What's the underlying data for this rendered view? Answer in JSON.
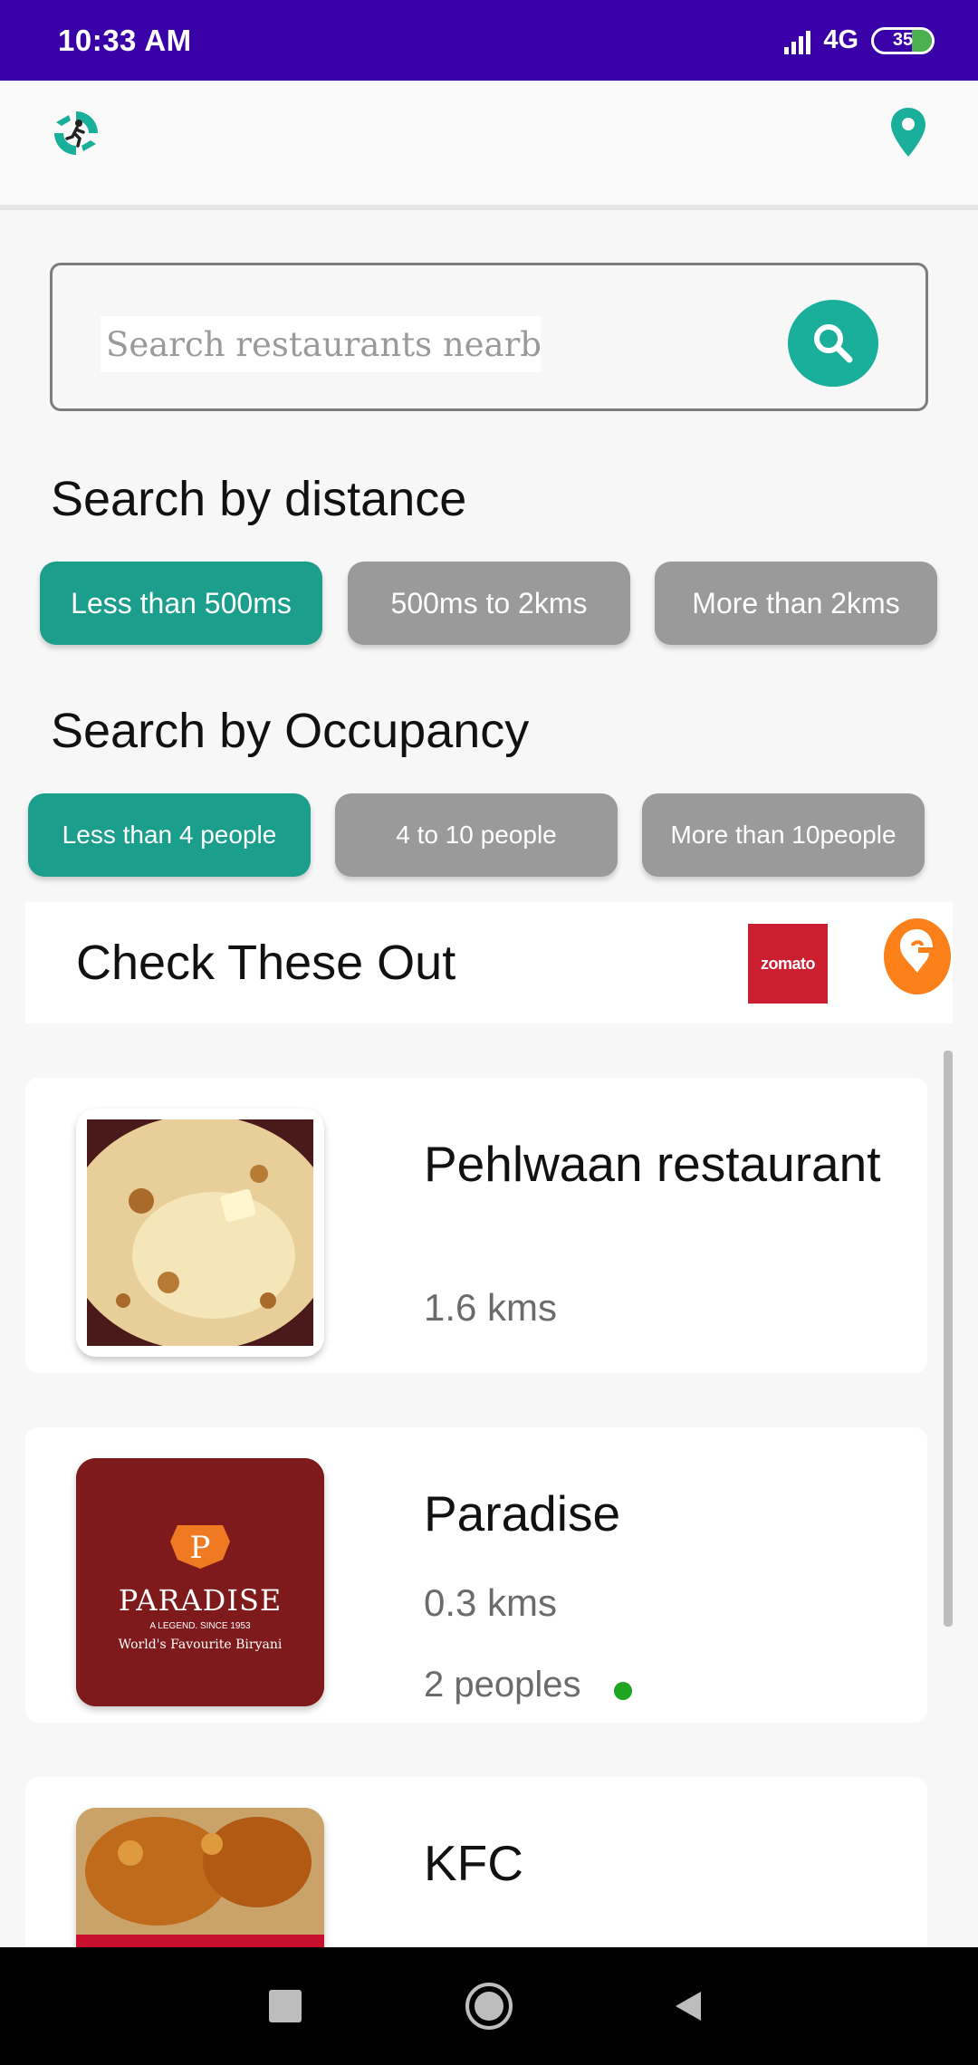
{
  "status_bar": {
    "time": "10:33 AM",
    "network": "4G",
    "battery": "35"
  },
  "app_bar": {
    "logo_icon": "runner-logo-icon",
    "location_icon": "location-pin-icon",
    "accent": "#1aaf9b"
  },
  "search": {
    "placeholder": "Search restaurants nearby",
    "value": "",
    "button_icon": "search-icon"
  },
  "distance": {
    "heading": "Search by distance",
    "options": [
      {
        "label": "Less than 500ms",
        "selected": true
      },
      {
        "label": "500ms to 2kms",
        "selected": false
      },
      {
        "label": "More than 2kms",
        "selected": false
      }
    ]
  },
  "occupancy": {
    "heading": "Search by Occupancy",
    "options": [
      {
        "label": "Less than 4 people",
        "selected": true
      },
      {
        "label": "4 to 10 people",
        "selected": false
      },
      {
        "label": "More than 10people",
        "selected": false
      }
    ]
  },
  "banner": {
    "title": "Check These Out",
    "partners": [
      {
        "name": "zomato",
        "icon": "zomato-logo",
        "color": "#cb1f2f"
      },
      {
        "name": "swiggy",
        "icon": "swiggy-logo",
        "color": "#fc8019"
      }
    ]
  },
  "restaurants": [
    {
      "name": "Pehlwaan restaurant",
      "distance": "1.6 kms",
      "occupancy": "",
      "image": "paratha-photo"
    },
    {
      "name": "Paradise",
      "distance": "0.3 kms",
      "occupancy": "2 peoples",
      "status_color": "#1fa51f",
      "image": "paradise-logo",
      "logo_text": {
        "brand": "PARADISE",
        "tagline": "A LEGEND. SINCE 1953",
        "slogan": "World's Favourite Biryani"
      }
    },
    {
      "name": "KFC",
      "distance": "",
      "occupancy": "",
      "image": "fried-chicken-photo"
    }
  ],
  "colors": {
    "status_bar": "#3a00a8",
    "chip_active": "#1c9e8d",
    "chip_inactive": "#9a9a9a"
  }
}
